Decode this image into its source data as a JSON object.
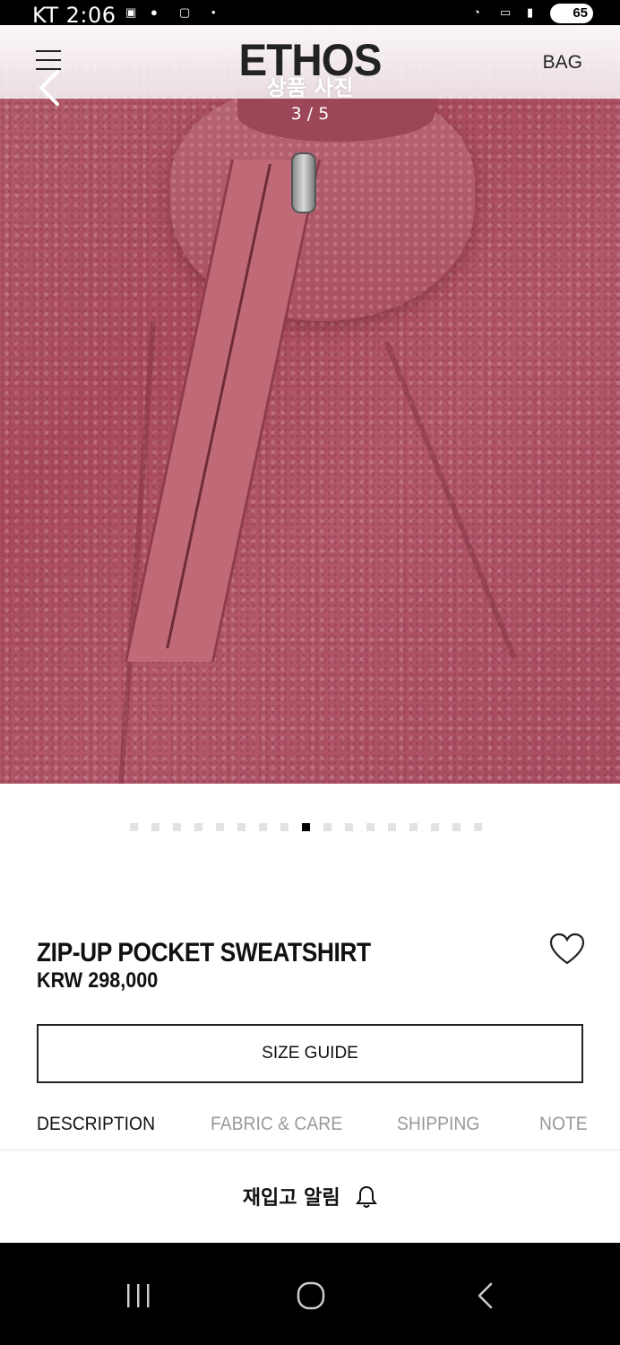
{
  "status_bar": {
    "carrier_time": "KT 2:06",
    "battery": "65"
  },
  "header": {
    "brand": "ETHOS",
    "bag_label": "BAG"
  },
  "viewer": {
    "title": "상품 사진",
    "counter": "3 / 5"
  },
  "carousel": {
    "total_dots": 17,
    "active_index": 8
  },
  "product": {
    "name": "ZIP-UP POCKET SWEATSHIRT",
    "price": "KRW 298,000",
    "size_guide_label": "SIZE GUIDE"
  },
  "tabs": [
    {
      "label": "DESCRIPTION",
      "active": true
    },
    {
      "label": "FABRIC & CARE",
      "active": false
    },
    {
      "label": "SHIPPING",
      "active": false
    },
    {
      "label": "NOTE",
      "active": false
    }
  ],
  "restock": {
    "label": "재입고 알림"
  },
  "icons": [
    "menu-icon",
    "back-icon",
    "heart-icon",
    "bell-icon",
    "recent-apps-icon",
    "home-icon",
    "back-nav-icon"
  ],
  "colors": {
    "accent": "#111111",
    "inactive_tab": "#999999"
  }
}
